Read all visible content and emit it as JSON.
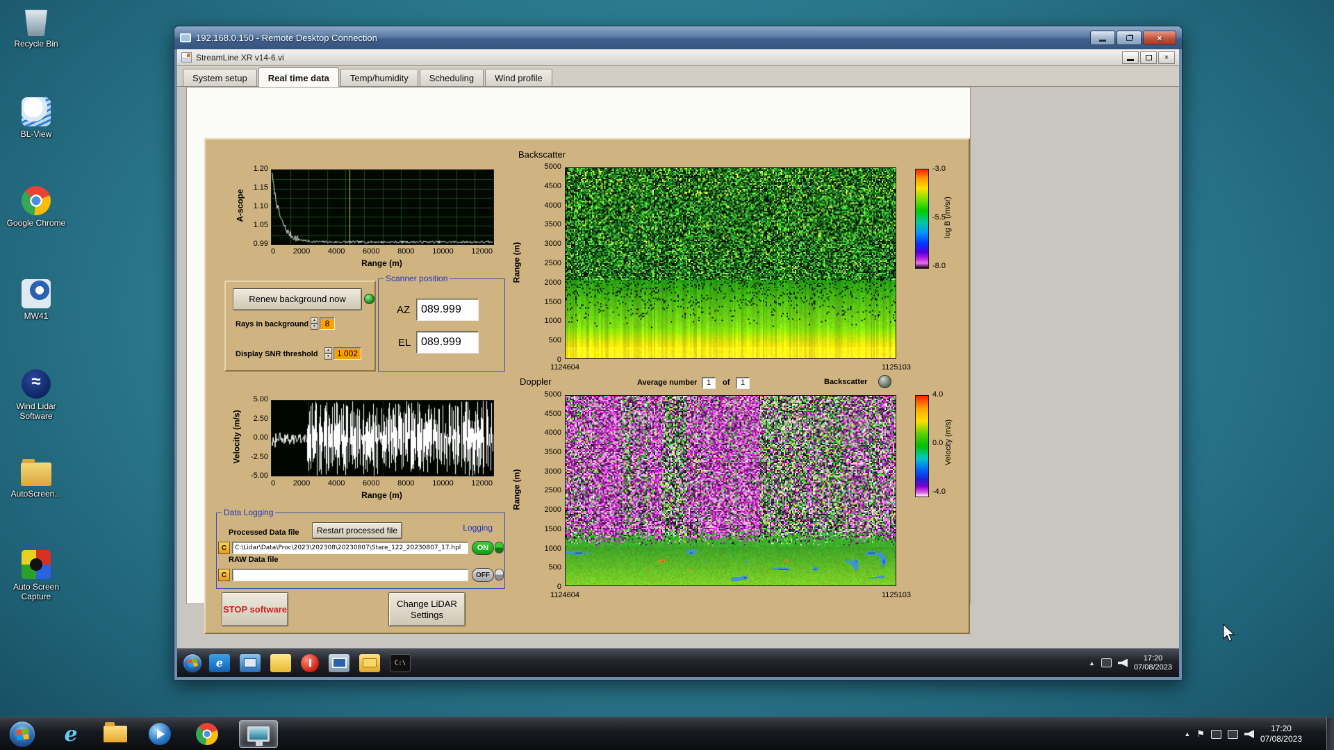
{
  "desktop_icons": [
    {
      "id": "recycle-bin",
      "label": "Recycle Bin"
    },
    {
      "id": "bl-view",
      "label": "BL-View"
    },
    {
      "id": "google-chrome",
      "label": "Google Chrome"
    },
    {
      "id": "mw41",
      "label": "MW41"
    },
    {
      "id": "wind-lidar-software",
      "label": "Wind Lidar Software"
    },
    {
      "id": "autoscreen",
      "label": "AutoScreen..."
    },
    {
      "id": "auto-screen-capture",
      "label": "Auto Screen Capture"
    }
  ],
  "rdp": {
    "title": "192.168.0.150 - Remote Desktop Connection"
  },
  "app": {
    "title": "StreamLine XR v14-6.vi",
    "tabs": [
      "System setup",
      "Real time data",
      "Temp/humidity",
      "Scheduling",
      "Wind profile"
    ],
    "active_tab": "Real time data"
  },
  "panel": {
    "renew_button": "Renew background now",
    "rays_label": "Rays in background",
    "rays_value": "8",
    "snr_label": "Display SNR threshold",
    "snr_value": "1.002",
    "scanner": {
      "title": "Scanner position",
      "az_label": "AZ",
      "az": "089.999",
      "el_label": "EL",
      "el": "089.999"
    },
    "doppler_bar": {
      "avg_label": "Average number",
      "avg": "1",
      "of": "of",
      "count": "1",
      "backscatter_label": "Backscatter"
    },
    "logging": {
      "title": "Data Logging",
      "processed_label": "Processed Data file",
      "restart_button": "Restart processed file",
      "logging_label": "Logging",
      "drive": "C",
      "processed_path": "C:\\Lidar\\Data\\Proc\\2023\\202308\\20230807\\Stare_122_20230807_17.hpl",
      "on": "ON",
      "raw_label": "RAW Data file",
      "raw_path": "",
      "off": "OFF"
    },
    "stop_button": "STOP software",
    "change_button": "Change LiDAR Settings"
  },
  "chart_data": [
    {
      "id": "ascope",
      "type": "line",
      "title": "",
      "ylabel": "A-scope",
      "xlabel": "Range (m)",
      "yticks": [
        "1.20",
        "1.15",
        "1.10",
        "1.05",
        "0.99"
      ],
      "xticks": [
        "0",
        "2000",
        "4000",
        "6000",
        "8000",
        "10000",
        "12000"
      ],
      "ylim": [
        0.99,
        1.2
      ],
      "xlim": [
        0,
        12000
      ],
      "series_note": "background level 1.20 at 0 m decaying to ~1.00 by 2000 m, flat noisy floor beyond; vertical cursor near 4200 m",
      "marker_x": 4200
    },
    {
      "id": "backscatter",
      "type": "heatmap",
      "title": "Backscatter",
      "ylabel": "Range (m)",
      "yticks": [
        "5000",
        "4500",
        "4000",
        "3500",
        "3000",
        "2500",
        "2000",
        "1500",
        "1000",
        "500",
        "0"
      ],
      "x_start_label": "1124604",
      "x_end_label": "1125103",
      "colorbar": {
        "label": "log B (/m/sr)",
        "ticks": [
          "-3.0",
          "-5.5",
          "-8.0"
        ]
      },
      "description": "strong yellow backscatter below ~700 m fading through green, dark speckle noise above ~2500 m, brighter speckle band near 5000 m"
    },
    {
      "id": "velocity",
      "type": "line",
      "title": "",
      "ylabel": "Velocity (m/s)",
      "xlabel": "Range (m)",
      "yticks": [
        "5.00",
        "2.50",
        "0.00",
        "-2.50",
        "-5.00"
      ],
      "xticks": [
        "0",
        "2000",
        "4000",
        "6000",
        "8000",
        "10000",
        "12000"
      ],
      "ylim": [
        -5,
        5
      ],
      "xlim": [
        0,
        12000
      ],
      "series_note": "velocity near 0 m/s out to ~2000 m, saturated full-scale noise bars beyond"
    },
    {
      "id": "doppler",
      "type": "heatmap",
      "title": "Doppler",
      "ylabel": "Range (m)",
      "yticks": [
        "5000",
        "4500",
        "4000",
        "3500",
        "3000",
        "2500",
        "2000",
        "1500",
        "1000",
        "500",
        "0"
      ],
      "x_start_label": "1124604",
      "x_end_label": "1125103",
      "colorbar": {
        "label": "Velocity (m/s)",
        "ticks": [
          "4.0",
          "0.0",
          "-4.0"
        ]
      },
      "description": "coherent green/yellow returns below ~1000 m with cyan-blue and orange patches, magenta noise streaks above"
    }
  ],
  "inner_taskbar": {
    "time": "17:20",
    "date": "07/08/2023",
    "icons": [
      "ie",
      "explorer",
      "notes",
      "power",
      "capture",
      "folder",
      "cmd"
    ]
  },
  "taskbar": {
    "time": "17:20",
    "date": "07/08/2023"
  }
}
